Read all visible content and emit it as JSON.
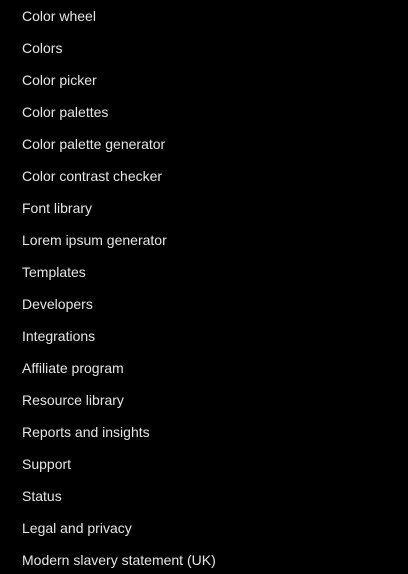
{
  "menu": {
    "items": [
      {
        "label": "Color wheel"
      },
      {
        "label": "Colors"
      },
      {
        "label": "Color picker"
      },
      {
        "label": "Color palettes"
      },
      {
        "label": "Color palette generator"
      },
      {
        "label": "Color contrast checker"
      },
      {
        "label": "Font library"
      },
      {
        "label": "Lorem ipsum generator"
      },
      {
        "label": "Templates"
      },
      {
        "label": "Developers"
      },
      {
        "label": "Integrations"
      },
      {
        "label": "Affiliate program"
      },
      {
        "label": "Resource library"
      },
      {
        "label": "Reports and insights"
      },
      {
        "label": "Support"
      },
      {
        "label": "Status"
      },
      {
        "label": "Legal and privacy"
      },
      {
        "label": "Modern slavery statement (UK)"
      }
    ]
  },
  "colors": {
    "background": "#000000",
    "text": "#e6e6e6"
  }
}
